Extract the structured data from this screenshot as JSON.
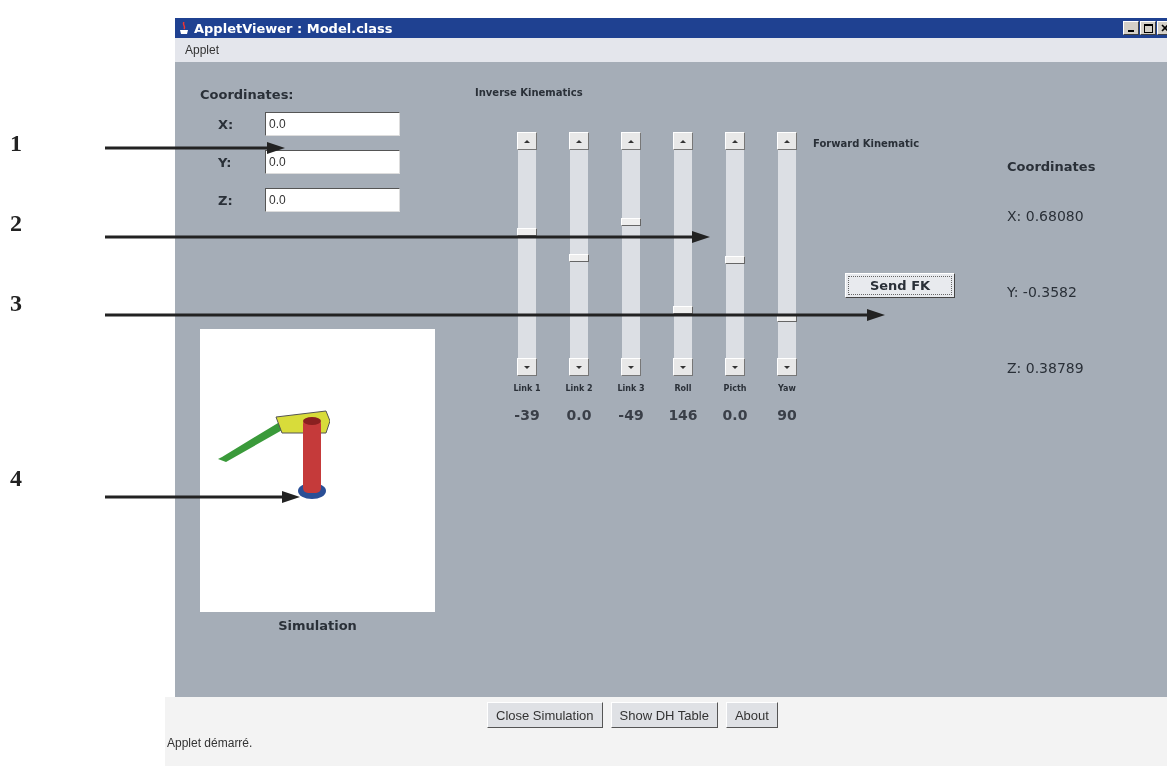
{
  "window": {
    "title": "AppletViewer : Model.class",
    "menu": [
      "Applet"
    ]
  },
  "coordinates": {
    "title": "Coordinates:",
    "fields": [
      {
        "label": "X:",
        "value": "0.0"
      },
      {
        "label": "Y:",
        "value": "0.0"
      },
      {
        "label": "Z:",
        "value": "0.0"
      }
    ]
  },
  "simulation": {
    "label": "Simulation"
  },
  "inverse_kinematics": {
    "title": "Inverse Kinematics",
    "sliders": [
      {
        "label": "Link 1",
        "level": 0.61,
        "value": "-39"
      },
      {
        "label": "Link 2",
        "level": 0.48,
        "value": "0.0"
      },
      {
        "label": "Link 3",
        "level": 0.66,
        "value": "-49"
      },
      {
        "label": "Roll",
        "level": 0.22,
        "value": "146"
      },
      {
        "label": "Picth",
        "level": 0.47,
        "value": "0.0"
      },
      {
        "label": "Yaw",
        "level": 0.18,
        "value": "90"
      }
    ]
  },
  "forward_kinematics": {
    "title": "Forward Kinematic",
    "button": "Send FK"
  },
  "result": {
    "title": "Coordinates",
    "lines": [
      "X: 0.68080",
      "Y: -0.3582",
      "Z: 0.38789"
    ]
  },
  "buttons": [
    "Close Simulation",
    "Show DH Table",
    "About"
  ],
  "status_bar": "Applet démarré.",
  "callouts": [
    "1",
    "2",
    "3",
    "4"
  ]
}
